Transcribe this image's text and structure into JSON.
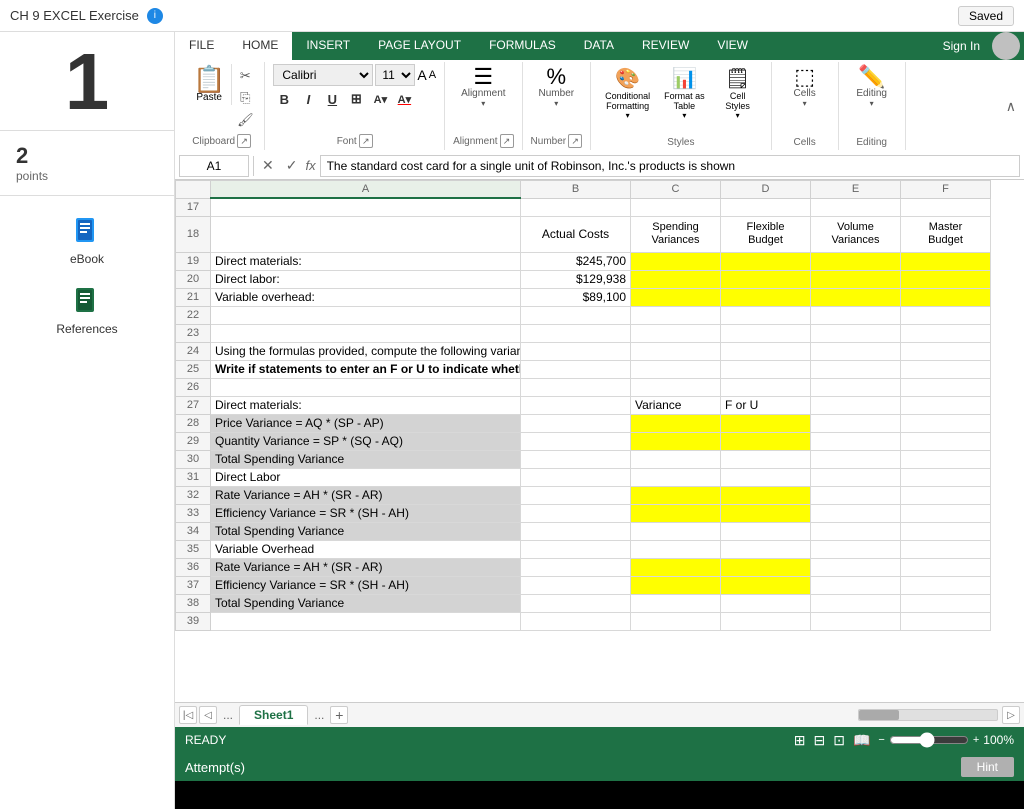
{
  "app": {
    "title": "CH 9 EXCEL Exercise",
    "saved_label": "Saved"
  },
  "sidebar": {
    "score": "1",
    "score_unit": "",
    "points_num": "2",
    "points_label": "points",
    "ebook_label": "eBook",
    "references_label": "References"
  },
  "ribbon": {
    "tabs": [
      "FILE",
      "HOME",
      "INSERT",
      "PAGE LAYOUT",
      "FORMULAS",
      "DATA",
      "REVIEW",
      "VIEW"
    ],
    "active_tab": "HOME",
    "sign_in_label": "Sign In",
    "groups": {
      "clipboard": {
        "label": "Clipboard",
        "paste_label": "Paste"
      },
      "font": {
        "label": "Font",
        "font_name": "Calibri",
        "font_size": "11"
      },
      "alignment": {
        "label": "Alignment",
        "button_label": "Alignment"
      },
      "number": {
        "label": "Number",
        "button_label": "Number"
      },
      "styles": {
        "label": "Styles",
        "conditional_label": "Conditional Formatting",
        "format_table_label": "Format as Table",
        "cell_styles_label": "Cell Styles"
      },
      "cells": {
        "label": "Cells",
        "button_label": "Cells"
      },
      "editing": {
        "label": "Editing",
        "button_label": "Editing"
      }
    }
  },
  "formula_bar": {
    "cell_ref": "A1",
    "formula_text": "The standard cost card for a single unit of Robinson, Inc.'s products is shown"
  },
  "columns": {
    "corner": "",
    "a_header": "A",
    "b_header": "B",
    "c_header": "C",
    "d_header": "D",
    "e_header": "E",
    "f_header": "F"
  },
  "rows": [
    {
      "num": "17",
      "a": "",
      "b": "",
      "c": "",
      "d": "",
      "e": "",
      "f": ""
    },
    {
      "num": "18",
      "a": "",
      "b": "Actual Costs",
      "c": "Spending\nVariances",
      "d": "Flexible\nBudget",
      "e": "Volume\nVariances",
      "f": "Master\nBudget",
      "header": true
    },
    {
      "num": "19",
      "a": "Direct materials:",
      "b": "$245,700",
      "c": "",
      "d": "",
      "e": "",
      "f": "",
      "c_yellow": true,
      "d_yellow": true,
      "e_yellow": true,
      "f_yellow": true
    },
    {
      "num": "20",
      "a": "Direct labor:",
      "b": "$129,938",
      "c": "",
      "d": "",
      "e": "",
      "f": "",
      "c_yellow": true,
      "d_yellow": true,
      "e_yellow": true,
      "f_yellow": true
    },
    {
      "num": "21",
      "a": "Variable overhead:",
      "b": "$89,100",
      "c": "",
      "d": "",
      "e": "",
      "f": "",
      "c_yellow": true,
      "d_yellow": true,
      "e_yellow": true,
      "f_yellow": true
    },
    {
      "num": "22",
      "a": "",
      "b": "",
      "c": "",
      "d": "",
      "e": "",
      "f": ""
    },
    {
      "num": "23",
      "a": "",
      "b": "",
      "c": "",
      "d": "",
      "e": "",
      "f": ""
    },
    {
      "num": "24",
      "a": "Using the formulas provided, compute the following variances.",
      "b": "",
      "c": "",
      "d": "",
      "e": "",
      "f": ""
    },
    {
      "num": "25",
      "a": "Write if statements to enter an  F or U to indicate whether the variance is favorable or unfavorable.",
      "b": "",
      "c": "",
      "d": "",
      "e": "",
      "f": "",
      "bold": true
    },
    {
      "num": "26",
      "a": "",
      "b": "",
      "c": "",
      "d": "",
      "e": "",
      "f": ""
    },
    {
      "num": "27",
      "a": "Direct materials:",
      "b": "",
      "c": "Variance",
      "d": "F or U",
      "e": "",
      "f": ""
    },
    {
      "num": "28",
      "a": "     Price Variance = AQ * (SP - AP)",
      "b": "",
      "c": "",
      "d": "",
      "e": "",
      "f": "",
      "a_gray": true,
      "c_yellow": true,
      "d_yellow": true
    },
    {
      "num": "29",
      "a": "     Quantity Variance = SP * (SQ - AQ)",
      "b": "",
      "c": "",
      "d": "",
      "e": "",
      "f": "",
      "a_gray": true,
      "c_yellow": true,
      "d_yellow": true
    },
    {
      "num": "30",
      "a": "     Total Spending Variance",
      "b": "",
      "c": "",
      "d": "",
      "e": "",
      "f": "",
      "a_gray": true
    },
    {
      "num": "31",
      "a": "Direct Labor",
      "b": "",
      "c": "",
      "d": "",
      "e": "",
      "f": ""
    },
    {
      "num": "32",
      "a": "     Rate Variance = AH * (SR - AR)",
      "b": "",
      "c": "",
      "d": "",
      "e": "",
      "f": "",
      "a_gray": true,
      "c_yellow": true,
      "d_yellow": true
    },
    {
      "num": "33",
      "a": "     Efficiency Variance = SR * (SH - AH)",
      "b": "",
      "c": "",
      "d": "",
      "e": "",
      "f": "",
      "a_gray": true,
      "c_yellow": true,
      "d_yellow": true
    },
    {
      "num": "34",
      "a": "     Total Spending Variance",
      "b": "",
      "c": "",
      "d": "",
      "e": "",
      "f": "",
      "a_gray": true
    },
    {
      "num": "35",
      "a": "Variable Overhead",
      "b": "",
      "c": "",
      "d": "",
      "e": "",
      "f": ""
    },
    {
      "num": "36",
      "a": "     Rate Variance = AH * (SR - AR)",
      "b": "",
      "c": "",
      "d": "",
      "e": "",
      "f": "",
      "a_gray": true,
      "c_yellow": true,
      "d_yellow": true
    },
    {
      "num": "37",
      "a": "     Efficiency Variance = SR * (SH - AH)",
      "b": "",
      "c": "",
      "d": "",
      "e": "",
      "f": "",
      "a_gray": true,
      "c_yellow": true,
      "d_yellow": true
    },
    {
      "num": "38",
      "a": "     Total Spending Variance",
      "b": "",
      "c": "",
      "d": "",
      "e": "",
      "f": "",
      "a_gray": true
    },
    {
      "num": "39",
      "a": "",
      "b": "",
      "c": "",
      "d": "",
      "e": "",
      "f": ""
    }
  ],
  "sheet_tabs": {
    "tabs": [
      "Sheet1"
    ],
    "active": "Sheet1"
  },
  "status_bar": {
    "ready_label": "READY",
    "zoom_label": "100%"
  },
  "attempt_bar": {
    "label": "Attempt(s)",
    "hint_label": "Hint"
  }
}
